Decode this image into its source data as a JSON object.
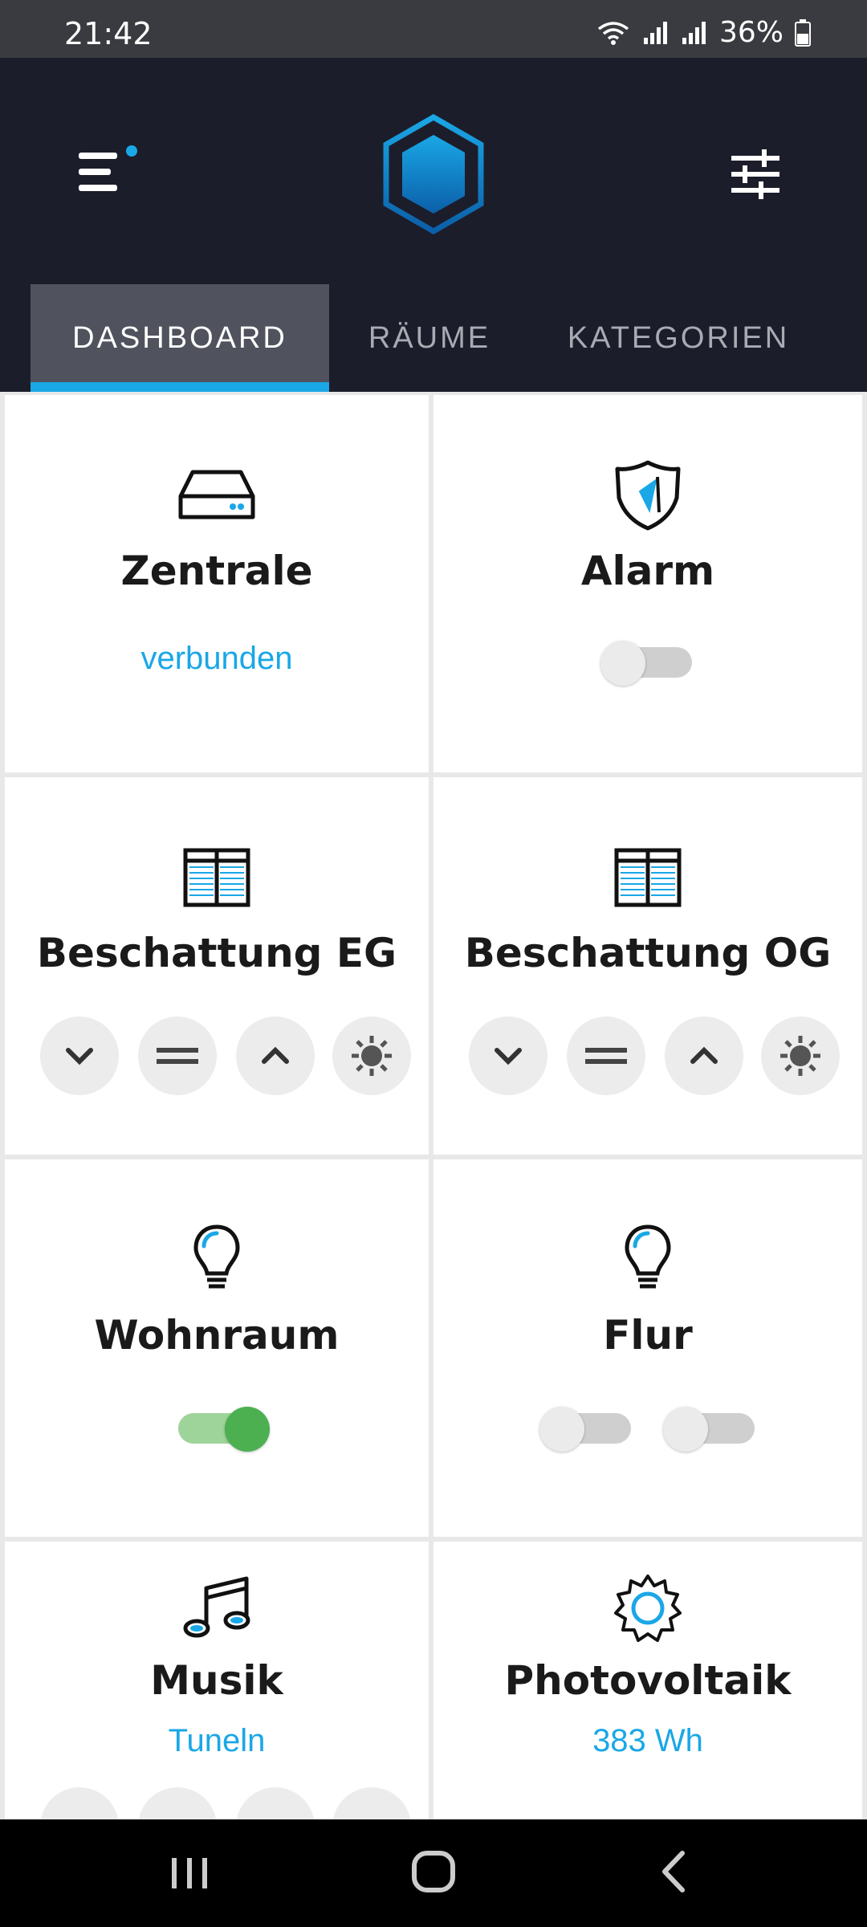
{
  "status": {
    "time": "21:42",
    "battery": "36%"
  },
  "tabs": [
    {
      "label": "DASHBOARD",
      "active": true
    },
    {
      "label": "RÄUME",
      "active": false
    },
    {
      "label": "KATEGORIEN",
      "active": false
    }
  ],
  "cards": {
    "zentrale": {
      "title": "Zentrale",
      "status": "verbunden"
    },
    "alarm": {
      "title": "Alarm",
      "toggle_on": false
    },
    "beschattung_eg": {
      "title": "Beschattung EG"
    },
    "beschattung_og": {
      "title": "Beschattung OG"
    },
    "wohnraum": {
      "title": "Wohnraum",
      "toggle_on": true
    },
    "flur": {
      "title": "Flur",
      "toggle1_on": false,
      "toggle2_on": false
    },
    "musik": {
      "title": "Musik",
      "status": "Tuneln"
    },
    "photovoltaik": {
      "title": "Photovoltaik",
      "status": "383 Wh"
    }
  },
  "colors": {
    "accent": "#1aa7e6",
    "header": "#1c1d2b",
    "toggle_on": "#4caf50"
  },
  "icons": [
    "hub-icon",
    "shield-icon",
    "shutter-icon",
    "bulb-icon",
    "music-icon",
    "sun-icon",
    "menu-icon",
    "logo-icon",
    "filter-icon"
  ]
}
